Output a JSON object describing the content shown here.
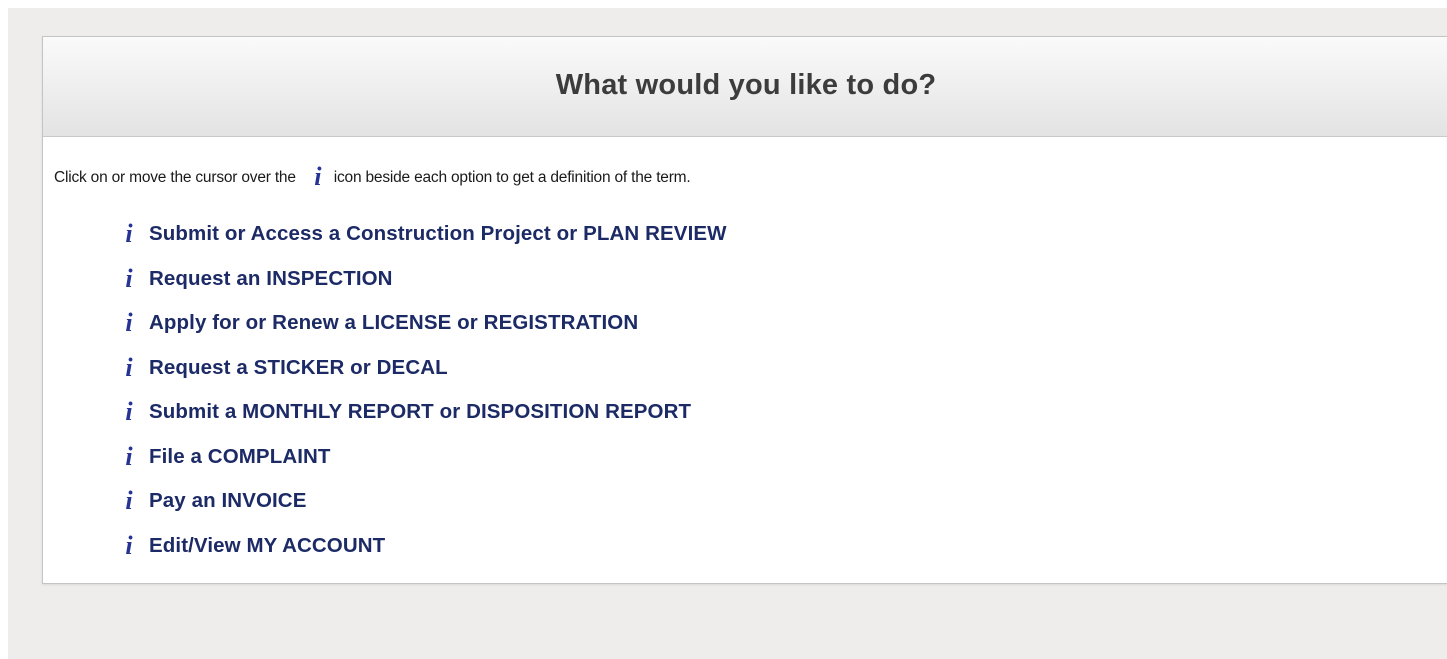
{
  "panel": {
    "title": "What would you like to do?"
  },
  "instructions": {
    "before_icon": "Click on or move the cursor over the",
    "after_icon": "icon beside each option to get a definition of the term.",
    "icon_glyph": "i"
  },
  "options": [
    {
      "label": "Submit or Access a Construction Project or PLAN REVIEW",
      "icon": "info-icon"
    },
    {
      "label": "Request an INSPECTION",
      "icon": "info-icon"
    },
    {
      "label": "Apply for or Renew a LICENSE or REGISTRATION",
      "icon": "info-icon"
    },
    {
      "label": "Request a STICKER or DECAL",
      "icon": "info-icon"
    },
    {
      "label": "Submit a MONTHLY REPORT or DISPOSITION REPORT",
      "icon": "info-icon"
    },
    {
      "label": "File a COMPLAINT",
      "icon": "info-icon"
    },
    {
      "label": "Pay an INVOICE",
      "icon": "info-icon"
    },
    {
      "label": "Edit/View MY ACCOUNT",
      "icon": "info-icon"
    }
  ],
  "colors": {
    "link": "#1c2a66",
    "info_icon": "#253494",
    "title": "#3c3c3c",
    "page_background": "#eeedeb"
  }
}
